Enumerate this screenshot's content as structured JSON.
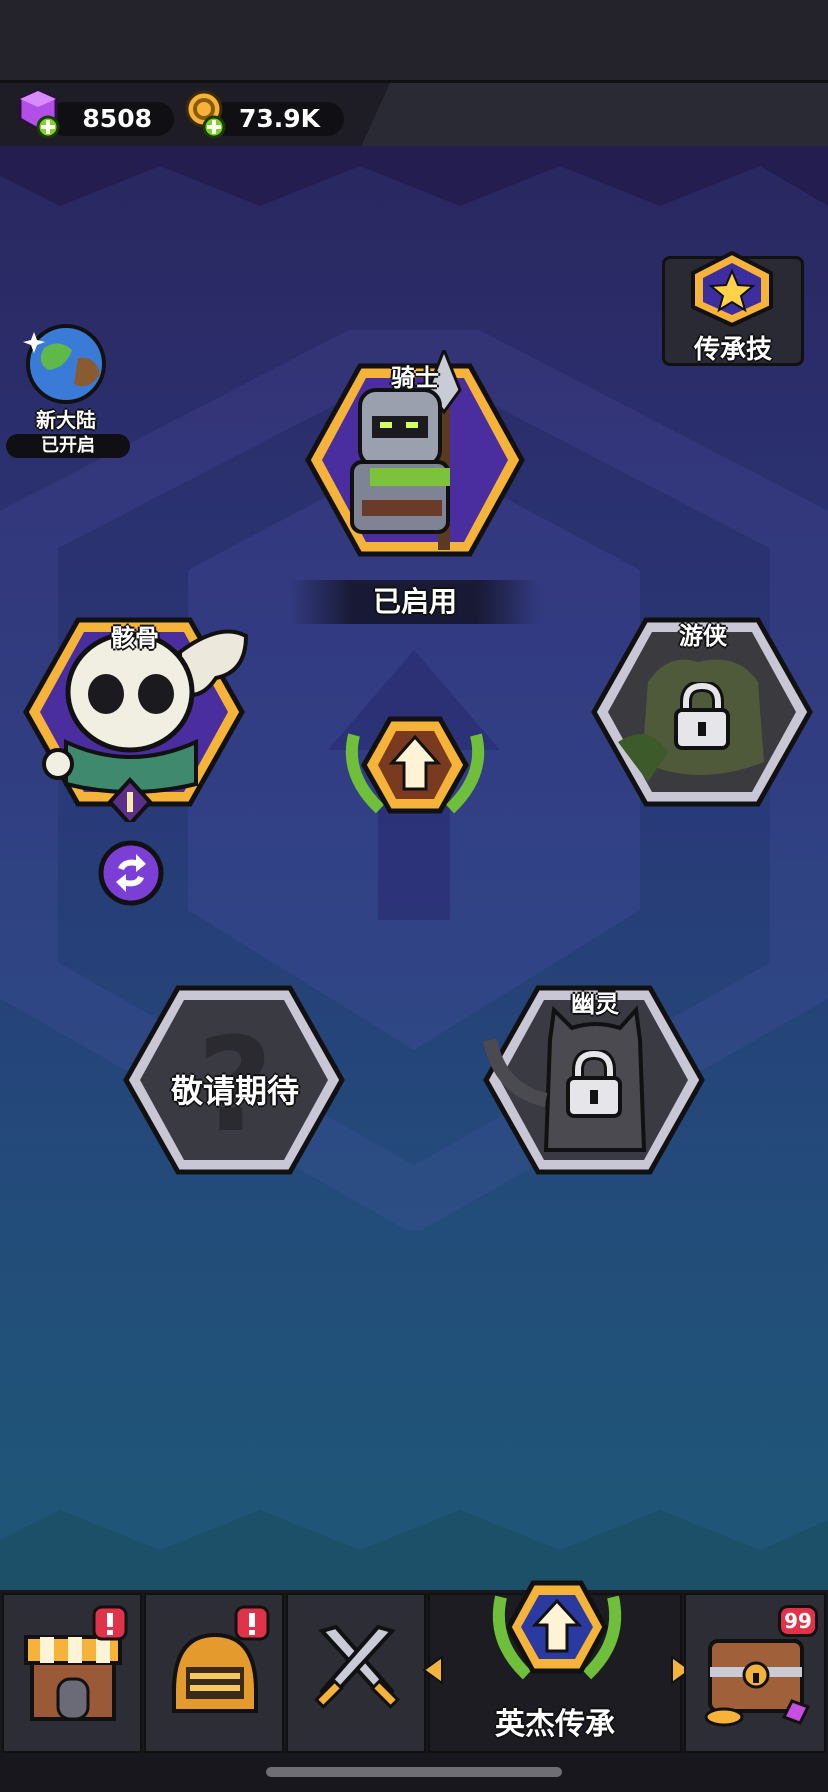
{
  "currency": {
    "gems": "8508",
    "gold": "73.9K",
    "gem_icon": "purple-gem-plus-icon",
    "gold_icon": "gold-coin-plus-icon"
  },
  "new_land": {
    "title": "新大陆",
    "status": "已开启",
    "icon": "planet-icon"
  },
  "legacy_skill": {
    "label": "传承技",
    "icon": "star-badge-icon"
  },
  "heroes": {
    "knight": {
      "name": "骑士",
      "status": "已启用"
    },
    "skeleton": {
      "name": "骸骨",
      "level": "I"
    },
    "ranger": {
      "name": "游侠"
    },
    "ghost": {
      "name": "幽灵"
    },
    "coming_soon": {
      "text": "敬请期待"
    }
  },
  "tabs": [
    {
      "name": "shop",
      "icon": "shop-icon",
      "badge": "!"
    },
    {
      "name": "equipment",
      "icon": "helmet-icon",
      "badge": "!"
    },
    {
      "name": "battle",
      "icon": "crossed-swords-icon"
    },
    {
      "name": "legacy",
      "label": "英杰传承",
      "icon": "upgrade-arrow-laurel-icon"
    },
    {
      "name": "chest",
      "icon": "treasure-chest-icon",
      "badge": "99"
    }
  ],
  "colors": {
    "accent_gold": "#f5b33a",
    "hex_purple": "#4a2ea0",
    "badge_red": "#e0334a",
    "gem_purple": "#a84de0"
  }
}
